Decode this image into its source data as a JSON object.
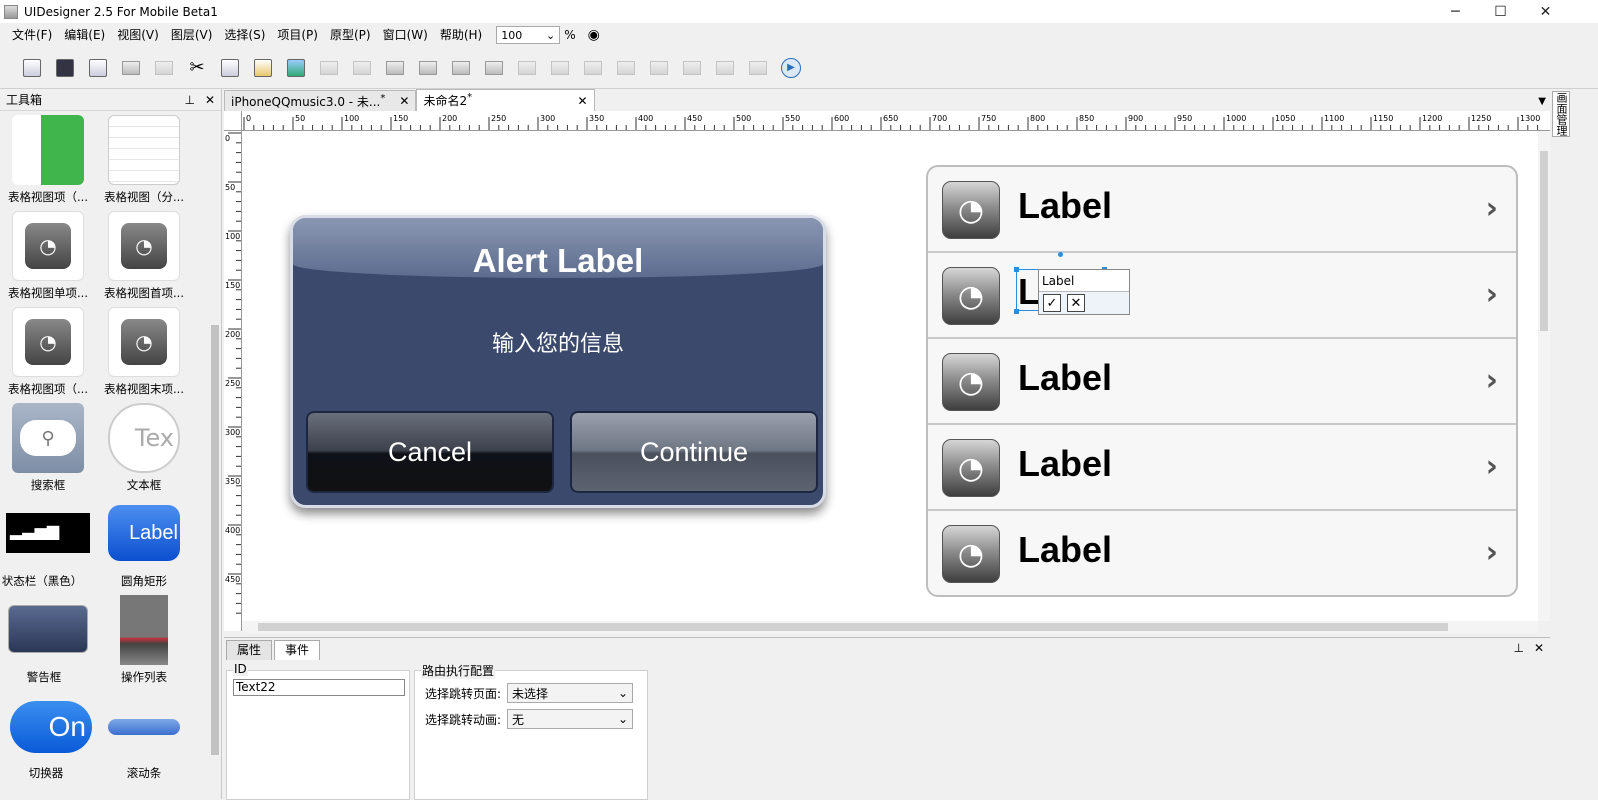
{
  "window": {
    "title": "UIDesigner 2.5 For Mobile Beta1"
  },
  "menu": [
    "文件(F)",
    "编辑(E)",
    "视图(V)",
    "图层(V)",
    "选择(S)",
    "项目(P)",
    "原型(P)",
    "窗口(W)",
    "帮助(H)"
  ],
  "zoom": {
    "value": "100",
    "unit": "%"
  },
  "toolbox": {
    "title": "工具箱",
    "items": [
      {
        "label": "表格视图项（..."
      },
      {
        "label": "表格视图（分..."
      },
      {
        "label": "表格视图单项..."
      },
      {
        "label": "表格视图首项..."
      },
      {
        "label": "表格视图项（..."
      },
      {
        "label": "表格视图末项..."
      },
      {
        "label": "搜索框"
      },
      {
        "label": "文本框"
      },
      {
        "label": "状态栏（黑色）"
      },
      {
        "label": "圆角矩形"
      },
      {
        "label": "警告框"
      },
      {
        "label": "操作列表"
      },
      {
        "label": "切换器"
      },
      {
        "label": "滚动条"
      }
    ],
    "thumb_text": {
      "textbox": "Tex",
      "roundrect": "Label",
      "switch": "On"
    }
  },
  "tabs": [
    {
      "label": "iPhoneQQmusic3.0 - 未...",
      "modified": "*",
      "active": false
    },
    {
      "label": "未命名2",
      "modified": "*",
      "active": true
    }
  ],
  "ruler": {
    "h_ticks": [
      "0",
      "50",
      "100",
      "150",
      "200",
      "250",
      "300",
      "350",
      "400",
      "450",
      "500",
      "550",
      "600",
      "650",
      "700",
      "750",
      "800",
      "850",
      "900",
      "950",
      "1000",
      "1050",
      "1100",
      "1150",
      "1200",
      "1250",
      "1300"
    ],
    "v_ticks": [
      "0",
      "50",
      "100",
      "150",
      "200",
      "250",
      "300",
      "350",
      "400",
      "450"
    ]
  },
  "alert": {
    "title": "Alert Label",
    "message": "输入您的信息",
    "cancel": "Cancel",
    "continue": "Continue"
  },
  "table_rows": [
    {
      "label": "Label"
    },
    {
      "label": "La"
    },
    {
      "label": "Label"
    },
    {
      "label": "Label"
    },
    {
      "label": "Label"
    }
  ],
  "inline_editor": {
    "text": "Label",
    "ok": "✓",
    "cancel": "✕"
  },
  "bottom_panel": {
    "tabs": [
      "属性",
      "事件"
    ],
    "active_tab": "事件",
    "id_group": {
      "label": "ID",
      "value": "Text22"
    },
    "route_group": {
      "label": "路由执行配置",
      "page_label": "选择跳转页面:",
      "page_value": "未选择",
      "anim_label": "选择跳转动画:",
      "anim_value": "无"
    }
  },
  "right_dock": {
    "label": "画面管理"
  },
  "colors": {
    "alert_bg": "#3b4a6c",
    "selection": "#2b8ce0",
    "canvas": "#ffffff"
  }
}
